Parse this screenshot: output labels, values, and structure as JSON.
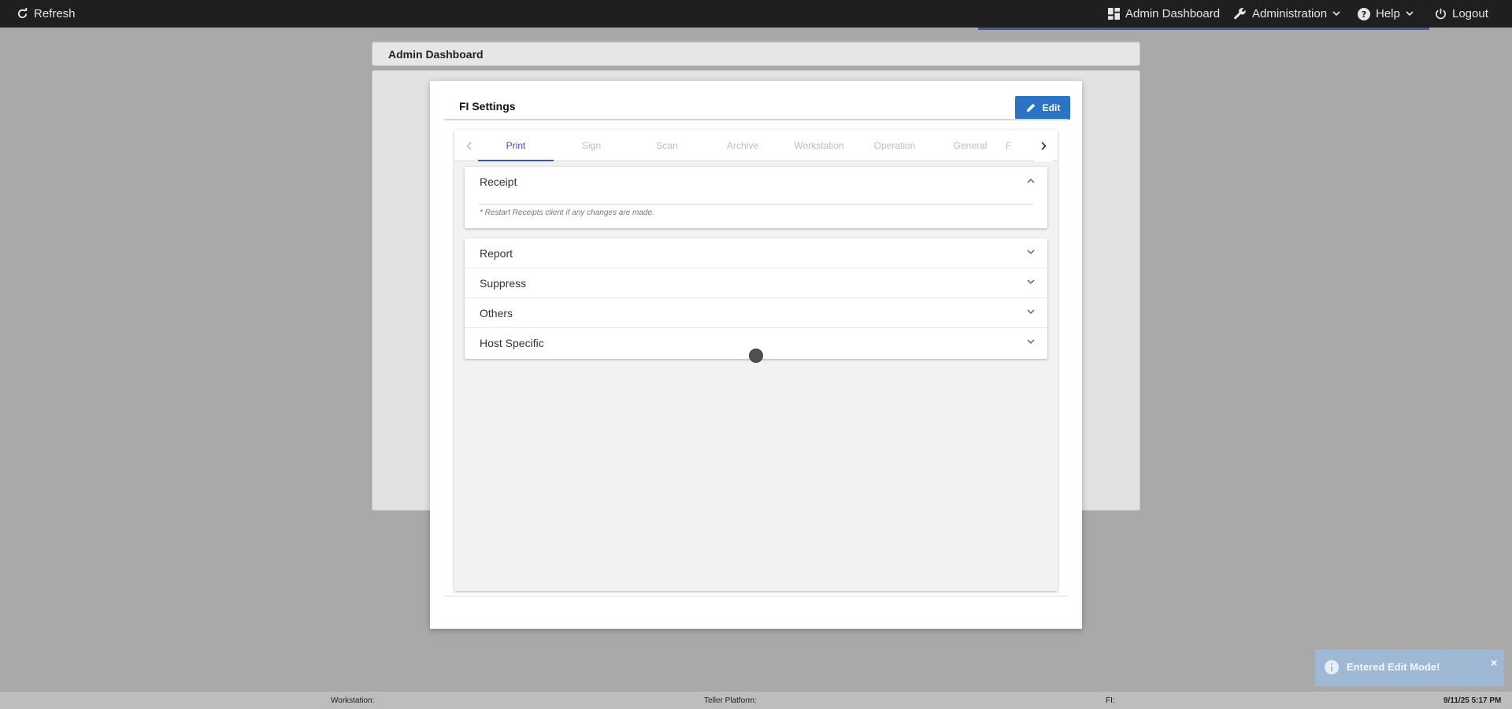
{
  "topbar": {
    "refresh_label": "Refresh",
    "admin_dashboard_label": "Admin Dashboard",
    "administration_label": "Administration",
    "help_label": "Help",
    "logout_label": "Logout"
  },
  "page": {
    "header_title": "Admin Dashboard"
  },
  "modal": {
    "title": "FI Settings",
    "edit_label": "Edit",
    "tabs": [
      {
        "label": "Print",
        "active": true
      },
      {
        "label": "Sign",
        "active": false
      },
      {
        "label": "Scan",
        "active": false
      },
      {
        "label": "Archive",
        "active": false
      },
      {
        "label": "Workstation",
        "active": false
      },
      {
        "label": "Operation",
        "active": false
      },
      {
        "label": "General",
        "active": false
      },
      {
        "label": "F",
        "active": false
      }
    ],
    "sections": {
      "receipt": {
        "label": "Receipt",
        "note": "* Restart Receipts client if any changes are made."
      },
      "report": {
        "label": "Report"
      },
      "suppress": {
        "label": "Suppress"
      },
      "others": {
        "label": "Others"
      },
      "host_specific": {
        "label": "Host Specific"
      }
    }
  },
  "toast": {
    "message": "Entered Edit Mode!",
    "close": "×"
  },
  "statusbar": {
    "workstation_label": "Workstation:",
    "teller_platform_label": "Teller Platform:",
    "fi_label": "FI:",
    "datetime": "9/11/25 5:17 PM"
  },
  "colors": {
    "topbar": "#1f1f1f",
    "accent": "#3f51b5",
    "edit_button": "#2b74c5",
    "toast": "#9fb9d4"
  }
}
